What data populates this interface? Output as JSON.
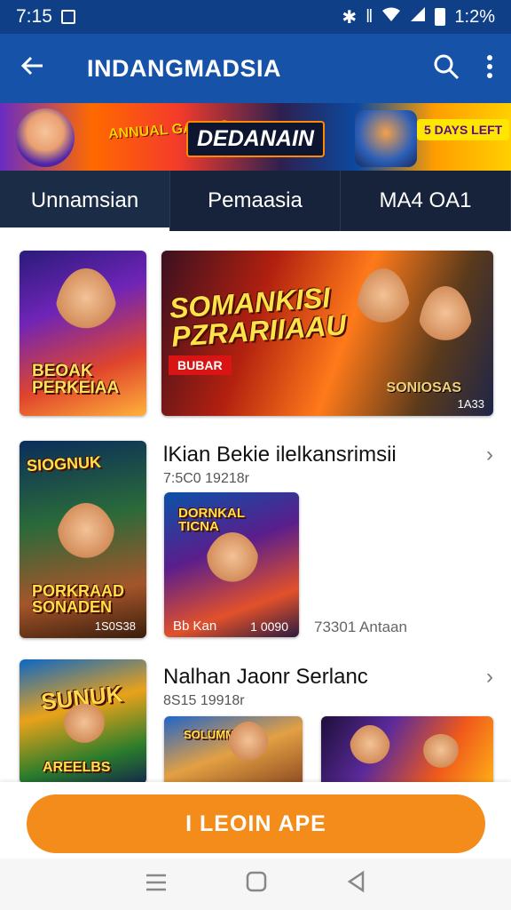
{
  "status_bar": {
    "time": "7:15",
    "battery_text": "1:2%"
  },
  "app_bar": {
    "title": "INDANGMADSIA"
  },
  "banner": {
    "badge_left": "ANNUAL GAMING",
    "main": "DEDANAIN",
    "badge_right": "5 DAYS LEFT"
  },
  "tabs": [
    {
      "label": "Unnamsian",
      "active": true
    },
    {
      "label": "Pemaasia",
      "active": false
    },
    {
      "label": "MA4 OA1",
      "active": false
    }
  ],
  "cards_row1": {
    "card1_title": "BEOAK PERKEIAA",
    "card2_title": "SOMANKISI PZRARIIAAU",
    "card2_badge": "BUBAR",
    "card2_emblem": "SONIOSAS",
    "card2_count": "1A33"
  },
  "section1": {
    "title": "lKian Bekie ilelkansrimsii",
    "subtitle": "7:5C0 19218r",
    "card3_top": "SIOGNUK",
    "card3_bottom": "PORKRAAD SONADEN",
    "card3_count": "1S0S38",
    "card4_top": "DORNKAL TICNA",
    "card4_label": "Bb Kan",
    "card4_count": "1 0090",
    "meta": "73301 Antaan"
  },
  "section2": {
    "title": "Nalhan Jaonr Serlanc",
    "subtitle": "8S15 19918r",
    "card5_top": "SUNUK",
    "card5_bottom": "AREELBS",
    "card6_top": "SOLUMMON"
  },
  "cta": {
    "label": "I LEOIN APE"
  },
  "colors": {
    "primary": "#1653a8",
    "status": "#0f3f86",
    "tabs_bg": "#16233a",
    "cta": "#f38c1a"
  },
  "icons": [
    "back-arrow-icon",
    "search-icon",
    "more-vert-icon",
    "wifi-icon",
    "signal-icon",
    "battery-icon",
    "bluetooth-icon",
    "chevron-right-icon",
    "nav-menu-icon",
    "nav-home-icon",
    "nav-back-icon"
  ]
}
